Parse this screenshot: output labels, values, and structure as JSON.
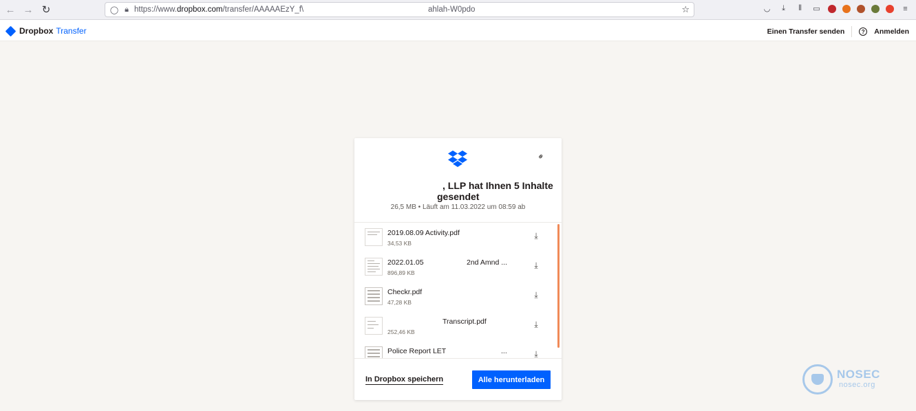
{
  "browser": {
    "url_scheme_prefix": "https://www.",
    "url_domain": "dropbox.com",
    "url_path": "/transfer/AAAAAEzY_f\\",
    "url_tail": "ahlah-W0pdo"
  },
  "header": {
    "brand_name": "Dropbox",
    "brand_suffix": "Transfer",
    "send_transfer": "Einen Transfer senden",
    "sign_in": "Anmelden"
  },
  "card": {
    "title_line1": ", LLP hat Ihnen 5 Inhalte",
    "title_line2": "gesendet",
    "meta": "26,5 MB • Läuft am 11.03.2022 um 08:59 ab",
    "files": [
      {
        "name": "2019.08.09 Activity.pdf",
        "size": "34,53 KB"
      },
      {
        "name": "2022.01.05",
        "name_tail": "2nd Amnd ...",
        "size": "896,89 KB"
      },
      {
        "name": "Checkr.pdf",
        "size": "47,28 KB"
      },
      {
        "name_tail": "Transcript.pdf",
        "size": "252,46 KB"
      },
      {
        "name": "Police Report LET",
        "name_tail": "...",
        "size": ""
      }
    ],
    "save_to_dropbox": "In Dropbox speichern",
    "download_all": "Alle herunterladen"
  },
  "watermark": {
    "name": "NOSEC",
    "site": "nosec.org"
  },
  "colors": {
    "dropbox_blue": "#0061fe",
    "scroll_accent": "#f08a58"
  }
}
